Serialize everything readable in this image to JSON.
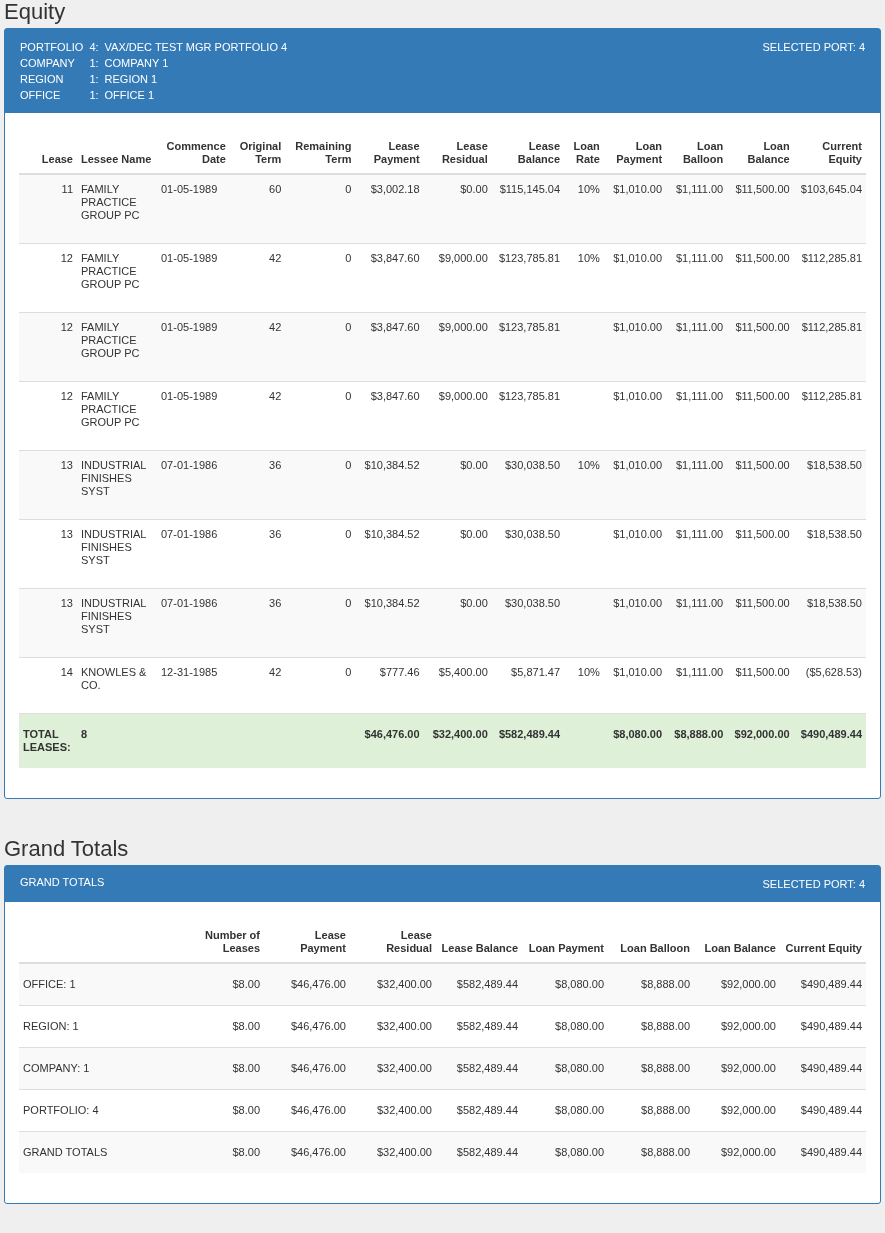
{
  "sections": [
    {
      "title": "Equity",
      "panel": {
        "info": [
          {
            "label": "PORTFOLIO",
            "number": "4:",
            "value": "VAX/DEC TEST MGR PORTFOLIO 4"
          },
          {
            "label": "COMPANY",
            "number": "1:",
            "value": "COMPANY 1"
          },
          {
            "label": "REGION",
            "number": "1:",
            "value": "REGION 1"
          },
          {
            "label": "OFFICE",
            "number": "1:",
            "value": "OFFICE 1"
          }
        ],
        "selected_port": "SELECTED PORT: 4",
        "table": {
          "kind": "detail",
          "columns": [
            "Lease",
            "Lessee Name",
            "Commence Date",
            "Original Term",
            "Remaining Term",
            "Lease Payment",
            "Lease Residual",
            "Lease Balance",
            "Loan Rate",
            "Loan Payment",
            "Loan Balloon",
            "Loan Balance",
            "Current Equity"
          ],
          "rows": [
            [
              "11",
              "FAMILY PRACTICE GROUP PC",
              "01-05-1989",
              "60",
              "0",
              "$3,002.18",
              "$0.00",
              "$115,145.04",
              "10%",
              "$1,010.00",
              "$1,111.00",
              "$11,500.00",
              "$103,645.04"
            ],
            [
              "12",
              "FAMILY PRACTICE GROUP PC",
              "01-05-1989",
              "42",
              "0",
              "$3,847.60",
              "$9,000.00",
              "$123,785.81",
              "10%",
              "$1,010.00",
              "$1,111.00",
              "$11,500.00",
              "$112,285.81"
            ],
            [
              "12",
              "FAMILY PRACTICE GROUP PC",
              "01-05-1989",
              "42",
              "0",
              "$3,847.60",
              "$9,000.00",
              "$123,785.81",
              null,
              "$1,010.00",
              "$1,111.00",
              "$11,500.00",
              "$112,285.81"
            ],
            [
              "12",
              "FAMILY PRACTICE GROUP PC",
              "01-05-1989",
              "42",
              "0",
              "$3,847.60",
              "$9,000.00",
              "$123,785.81",
              null,
              "$1,010.00",
              "$1,111.00",
              "$11,500.00",
              "$112,285.81"
            ],
            [
              "13",
              "INDUSTRIAL FINISHES SYST",
              "07-01-1986",
              "36",
              "0",
              "$10,384.52",
              "$0.00",
              "$30,038.50",
              "10%",
              "$1,010.00",
              "$1,111.00",
              "$11,500.00",
              "$18,538.50"
            ],
            [
              "13",
              "INDUSTRIAL FINISHES SYST",
              "07-01-1986",
              "36",
              "0",
              "$10,384.52",
              "$0.00",
              "$30,038.50",
              null,
              "$1,010.00",
              "$1,111.00",
              "$11,500.00",
              "$18,538.50"
            ],
            [
              "13",
              "INDUSTRIAL FINISHES SYST",
              "07-01-1986",
              "36",
              "0",
              "$10,384.52",
              "$0.00",
              "$30,038.50",
              null,
              "$1,010.00",
              "$1,111.00",
              "$11,500.00",
              "$18,538.50"
            ],
            [
              "14",
              "KNOWLES & CO.",
              "12-31-1985",
              "42",
              "0",
              "$777.46",
              "$5,400.00",
              "$5,871.47",
              "10%",
              "$1,010.00",
              "$1,111.00",
              "$11,500.00",
              "($5,628.53)"
            ]
          ],
          "total": {
            "label": "TOTAL LEASES:",
            "count": "8",
            "lease_payment": "$46,476.00",
            "lease_residual": "$32,400.00",
            "lease_balance": "$582,489.44",
            "loan_payment": "$8,080.00",
            "loan_balloon": "$8,888.00",
            "loan_balance": "$92,000.00",
            "current_equity": "$490,489.44"
          }
        }
      }
    },
    {
      "title": "Grand Totals",
      "panel": {
        "heading": "GRAND TOTALS",
        "selected_port": "SELECTED PORT: 4",
        "table": {
          "kind": "summary",
          "columns": [
            null,
            "Number of Leases",
            "Lease Payment",
            "Lease Residual",
            "Lease Balance",
            "Loan Payment",
            "Loan Balloon",
            "Loan Balance",
            "Current Equity"
          ],
          "rows": [
            [
              "OFFICE: 1",
              "$8.00",
              "$46,476.00",
              "$32,400.00",
              "$582,489.44",
              "$8,080.00",
              "$8,888.00",
              "$92,000.00",
              "$490,489.44"
            ],
            [
              "REGION: 1",
              "$8.00",
              "$46,476.00",
              "$32,400.00",
              "$582,489.44",
              "$8,080.00",
              "$8,888.00",
              "$92,000.00",
              "$490,489.44"
            ],
            [
              "COMPANY: 1",
              "$8.00",
              "$46,476.00",
              "$32,400.00",
              "$582,489.44",
              "$8,080.00",
              "$8,888.00",
              "$92,000.00",
              "$490,489.44"
            ],
            [
              "PORTFOLIO: 4",
              "$8.00",
              "$46,476.00",
              "$32,400.00",
              "$582,489.44",
              "$8,080.00",
              "$8,888.00",
              "$92,000.00",
              "$490,489.44"
            ],
            [
              "GRAND TOTALS",
              "$8.00",
              "$46,476.00",
              "$32,400.00",
              "$582,489.44",
              "$8,080.00",
              "$8,888.00",
              "$92,000.00",
              "$490,489.44"
            ]
          ]
        }
      }
    }
  ]
}
